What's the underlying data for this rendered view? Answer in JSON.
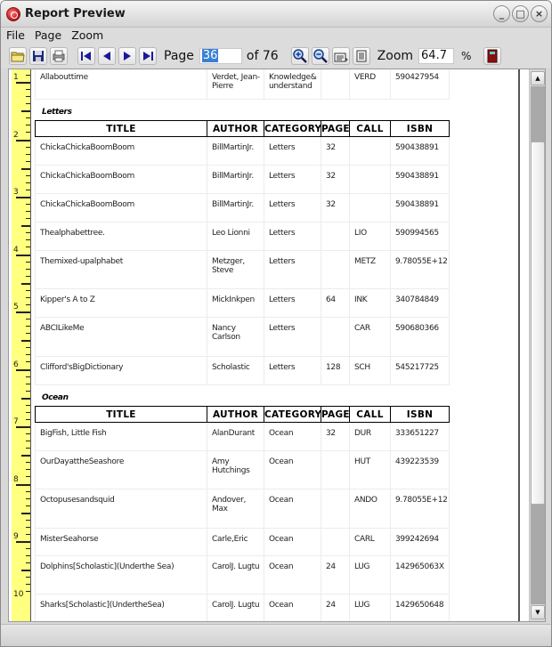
{
  "window": {
    "title": "Report Preview",
    "controls": [
      "_",
      "□",
      "×"
    ]
  },
  "menu": [
    "File",
    "Page",
    "Zoom"
  ],
  "toolbar": {
    "page_label": "Page",
    "page_value": "36",
    "page_of": "of 76",
    "zoom_label": "Zoom",
    "zoom_value": "64.7",
    "zoom_unit": "%",
    "icons": {
      "open": "open-folder-icon",
      "save": "save-disk-icon",
      "print": "print-icon",
      "first": "first-page-icon",
      "prev": "previous-page-icon",
      "next": "next-page-icon",
      "last": "last-page-icon",
      "zoom_in": "zoom-in-icon",
      "zoom_out": "zoom-out-icon",
      "page_width": "page-width-icon",
      "whole_page": "whole-page-icon",
      "exit": "exit-door-icon"
    }
  },
  "ruler": {
    "unit_labels": [
      "1",
      "2",
      "3",
      "4",
      "5",
      "6",
      "7",
      "8",
      "9",
      "10"
    ]
  },
  "report": {
    "columns": [
      "TITLE",
      "AUTHOR",
      "CATEGORY",
      "PAGES",
      "CALL",
      "ISBN"
    ],
    "previous_row": {
      "title": "Allabouttime",
      "author": "Verdet, Jean-Pierre",
      "category": "Knowledge& understand",
      "pages": "",
      "call": "VERD",
      "isbn": "590427954"
    },
    "sections": [
      {
        "name": "Letters",
        "rows": [
          {
            "title": "ChickaChickaBoomBoom",
            "author": "BillMartinJr.",
            "category": "Letters",
            "pages": "32",
            "call": "",
            "isbn": "590438891"
          },
          {
            "title": "ChickaChickaBoomBoom",
            "author": "BillMartinJr.",
            "category": "Letters",
            "pages": "32",
            "call": "",
            "isbn": "590438891"
          },
          {
            "title": "ChickaChickaBoomBoom",
            "author": "BillMartinJr.",
            "category": "Letters",
            "pages": "32",
            "call": "",
            "isbn": "590438891"
          },
          {
            "title": "Thealphabettree.",
            "author": "Leo Lionni",
            "category": "Letters",
            "pages": "",
            "call": "LIO",
            "isbn": "590994565"
          },
          {
            "title": "Themixed-upalphabet",
            "author": "Metzger, Steve",
            "category": "Letters",
            "pages": "",
            "call": "METZ",
            "isbn": "9.78055E+12"
          },
          {
            "title": "Kipper's A to Z",
            "author": "MickInkpen",
            "category": "Letters",
            "pages": "64",
            "call": "INK",
            "isbn": "340784849"
          },
          {
            "title": "ABCILikeMe",
            "author": "Nancy Carlson",
            "category": "Letters",
            "pages": "",
            "call": "CAR",
            "isbn": "590680366"
          },
          {
            "title": "Clifford'sBigDictionary",
            "author": "Scholastic",
            "category": "Letters",
            "pages": "128",
            "call": "SCH",
            "isbn": "545217725"
          }
        ]
      },
      {
        "name": "Ocean",
        "rows": [
          {
            "title": "BigFish, Little Fish",
            "author": "AlanDurant",
            "category": "Ocean",
            "pages": "32",
            "call": "DUR",
            "isbn": "333651227"
          },
          {
            "title": "OurDayattheSeashore",
            "author": "Amy Hutchings",
            "category": "Ocean",
            "pages": "",
            "call": "HUT",
            "isbn": "439223539"
          },
          {
            "title": "Octopusesandsquid",
            "author": "Andover, Max",
            "category": "Ocean",
            "pages": "",
            "call": "ANDO",
            "isbn": "9.78055E+12"
          },
          {
            "title": "MisterSeahorse",
            "author": "Carle,Eric",
            "category": "Ocean",
            "pages": "",
            "call": "CARL",
            "isbn": "399242694"
          },
          {
            "title": "Dolphins[Scholastic](Underthe Sea)",
            "author": "CarolJ. Lugtu",
            "category": "Ocean",
            "pages": "24",
            "call": "LUG",
            "isbn": "142965063X"
          },
          {
            "title": "Sharks[Scholastic](UndertheSea)",
            "author": "CarolJ. Lugtu",
            "category": "Ocean",
            "pages": "24",
            "call": "LUG",
            "isbn": "1429650648"
          }
        ]
      }
    ]
  },
  "scrollbar": {
    "up": "▲",
    "down": "▼",
    "position_fraction": 0.47
  }
}
